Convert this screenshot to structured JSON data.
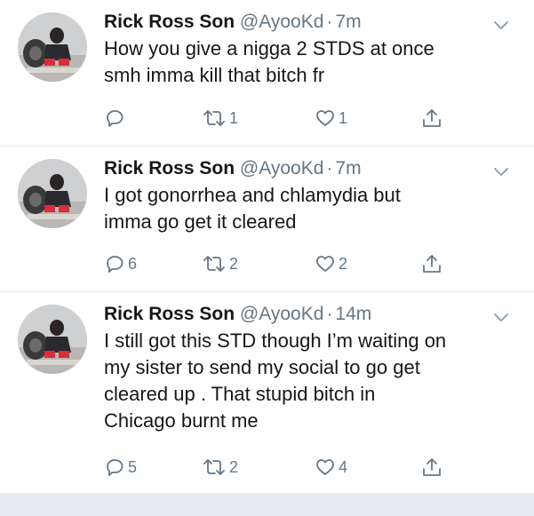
{
  "tweets": [
    {
      "display_name": "Rick Ross Son",
      "handle": "@AyooKd",
      "separator": "·",
      "time": "7m",
      "text": "How you give a nigga 2 STDS at once\nsmh imma kill that bitch fr",
      "replies": "",
      "retweets": "1",
      "likes": "1"
    },
    {
      "display_name": "Rick Ross Son",
      "handle": "@AyooKd",
      "separator": "·",
      "time": "7m",
      "text": "I got gonorrhea and chlamydia but\nimma go get it cleared",
      "replies": "6",
      "retweets": "2",
      "likes": "2"
    },
    {
      "display_name": "Rick Ross Son",
      "handle": "@AyooKd",
      "separator": "·",
      "time": "14m",
      "text": "I still got this STD though I’m waiting on\nmy sister to send my social to go get\ncleared up . That stupid bitch in\nChicago burnt me",
      "replies": "5",
      "retweets": "2",
      "likes": "4"
    }
  ],
  "icons": {
    "reply": "reply-icon",
    "retweet": "retweet-icon",
    "like": "heart-icon",
    "share": "share-icon",
    "caret": "chevron-down-icon"
  },
  "colors": {
    "text": "#14171a",
    "secondary": "#657786",
    "divider": "#e1e8ed",
    "footer": "#e6ecf0"
  }
}
